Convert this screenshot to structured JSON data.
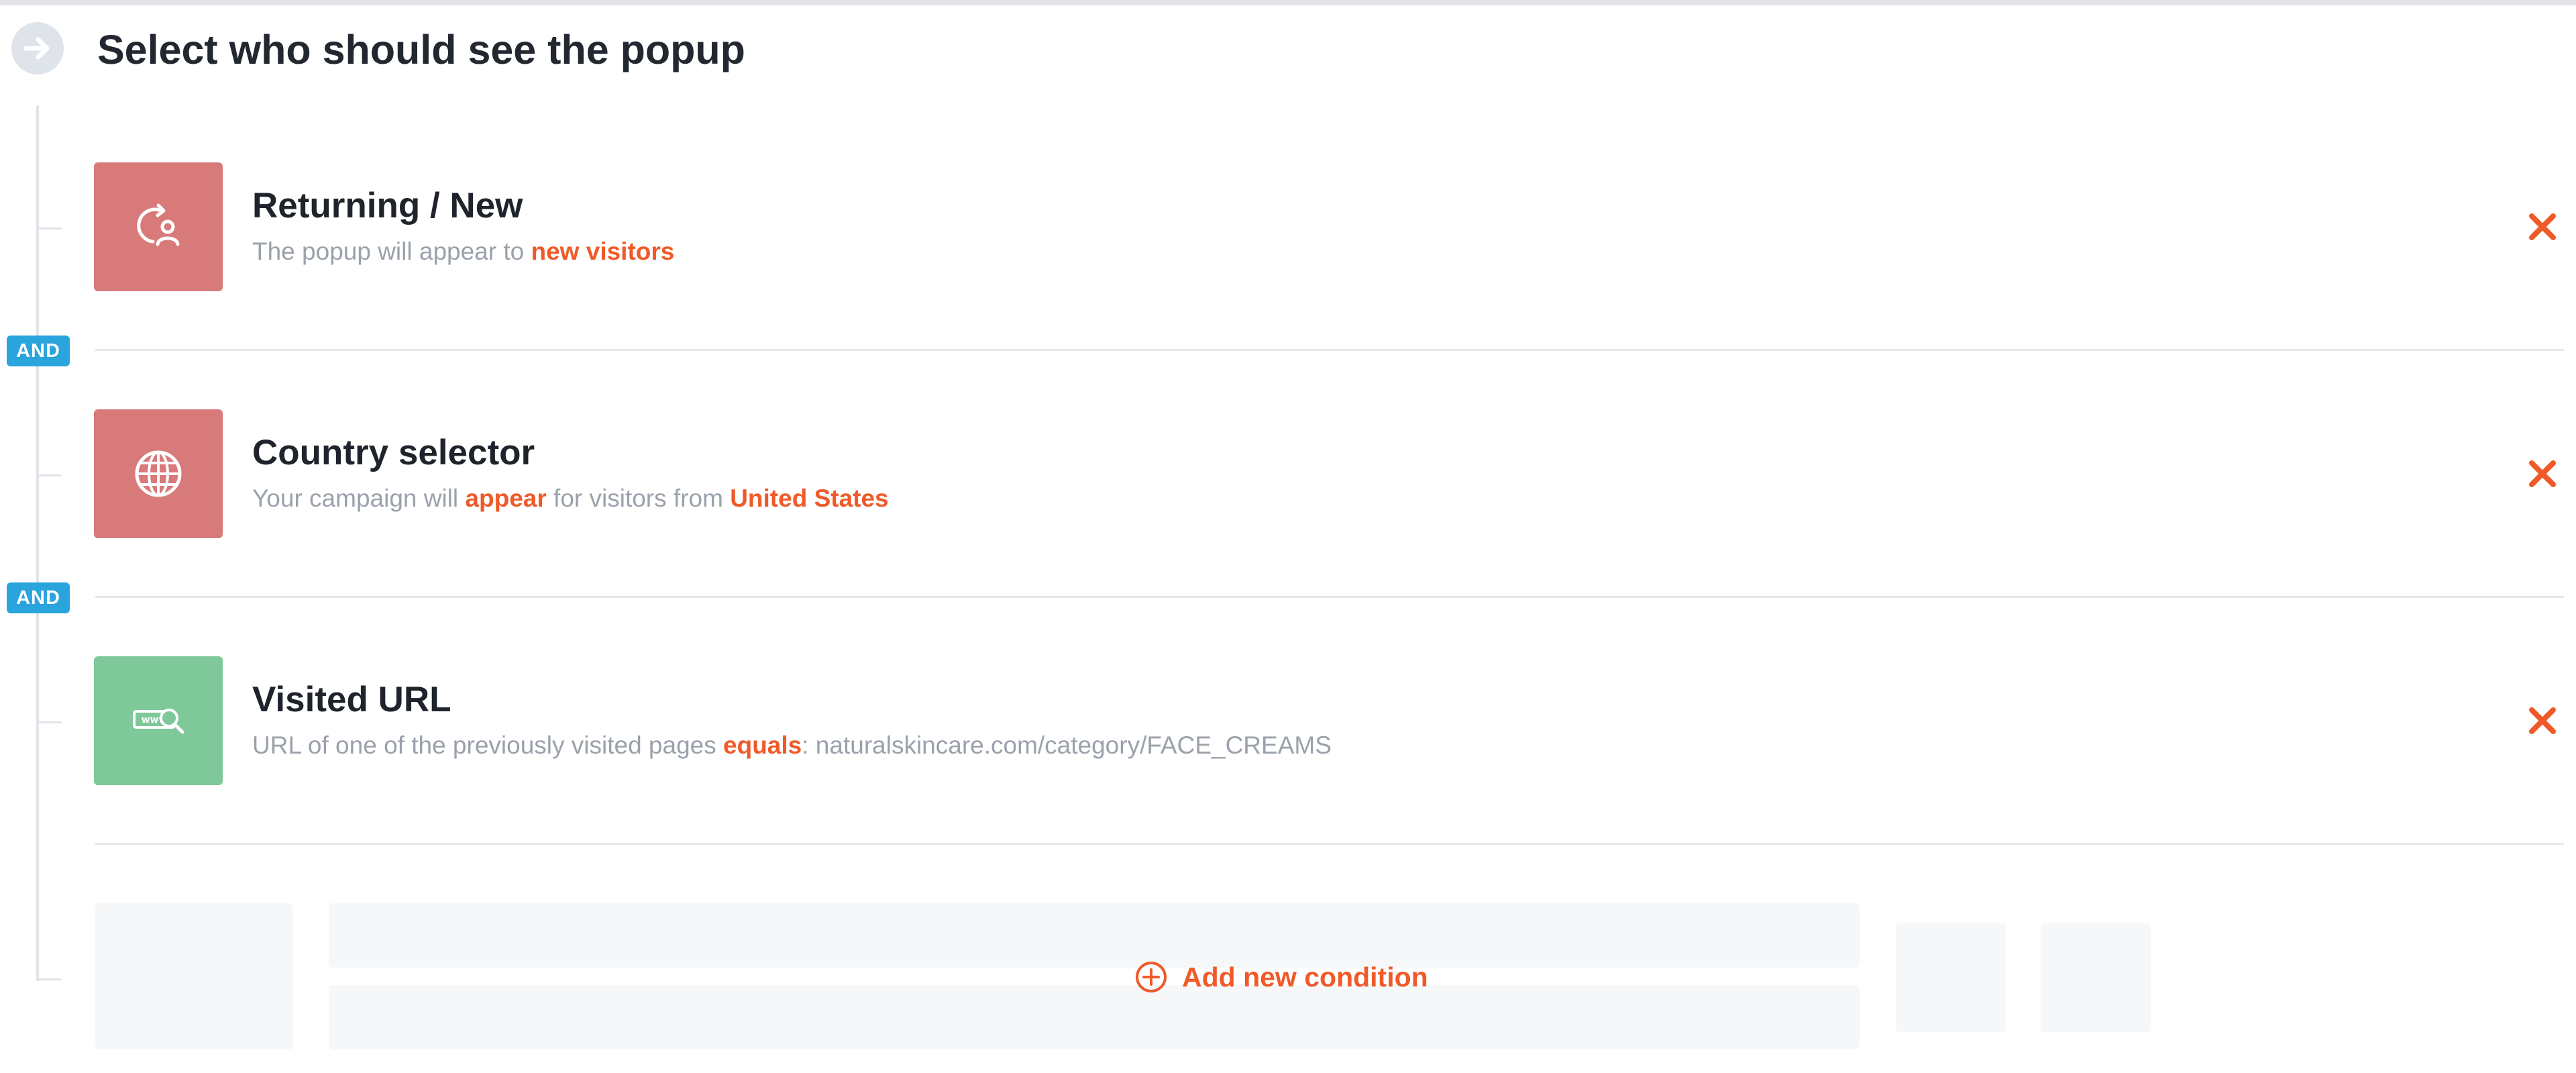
{
  "header": {
    "title": "Select who should see the popup",
    "icon": "arrow-right-circle-icon"
  },
  "connector_label": "AND",
  "conditions": [
    {
      "title": "Returning / New",
      "icon": "returning-visitor-icon",
      "icon_color": "#d97a7a",
      "desc_prefix": "The popup will appear to ",
      "desc_highlight": "new visitors"
    },
    {
      "title": "Country selector",
      "icon": "globe-icon",
      "icon_color": "#d97a7a",
      "desc_prefix": "Your campaign will ",
      "desc_highlight": "appear",
      "desc_middle": " for visitors from ",
      "desc_highlight2": "United States"
    },
    {
      "title": "Visited URL",
      "icon": "www-search-icon",
      "icon_color": "#7ec89a",
      "desc_prefix": "URL of one of the previously visited pages ",
      "desc_highlight": "equals",
      "desc_suffix": ": naturalskincare.com/category/FACE_CREAMS"
    }
  ],
  "add_condition": {
    "label": "Add new condition",
    "icon": "plus-circle-icon"
  },
  "colors": {
    "accent": "#f05a28",
    "and_badge": "#2aa4dd"
  }
}
